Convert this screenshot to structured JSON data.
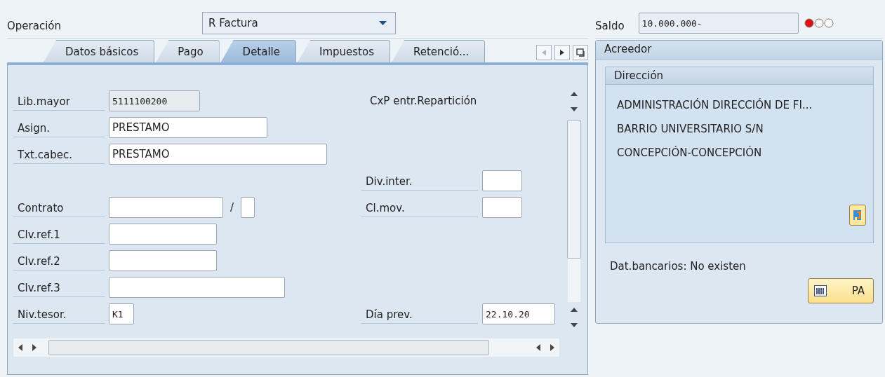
{
  "operation": {
    "label": "Operación",
    "value": "R Factura"
  },
  "tabs": [
    {
      "label": "Datos básicos",
      "selected": false
    },
    {
      "label": "Pago",
      "selected": false
    },
    {
      "label": "Detalle",
      "selected": true
    },
    {
      "label": "Impuestos",
      "selected": false
    },
    {
      "label": "Retenció...",
      "selected": false
    }
  ],
  "form": {
    "rows": [
      {
        "label": "Lib.mayor",
        "fields": [
          {
            "value": "5111100200",
            "kind": "display"
          }
        ],
        "right": {
          "kind": "text",
          "text": "CxP entr.Repartición"
        }
      },
      {
        "label": "Asign.",
        "fields": [
          {
            "value": "PRESTAMO",
            "kind": "input"
          }
        ]
      },
      {
        "label": "Txt.cabec.",
        "fields": [
          {
            "value": "PRESTAMO",
            "kind": "input"
          }
        ]
      },
      {
        "fields": [],
        "right": {
          "kind": "field",
          "label": "Div.inter."
        }
      },
      {
        "label": "Contrato",
        "fields": [
          {
            "kind": "input"
          },
          {
            "kind": "input"
          }
        ],
        "separator": "/",
        "right": {
          "kind": "field",
          "label": "Cl.mov."
        }
      },
      {
        "label": "Clv.ref.1",
        "fields": [
          {
            "kind": "input"
          }
        ]
      },
      {
        "label": "Clv.ref.2",
        "fields": [
          {
            "kind": "input"
          }
        ]
      },
      {
        "label": "Clv.ref.3",
        "fields": [
          {
            "kind": "input"
          }
        ]
      },
      {
        "label": "Niv.tesor.",
        "fields": [
          {
            "value": "K1",
            "kind": "mono"
          }
        ],
        "right": {
          "kind": "field",
          "label": "Día prev.",
          "value": "22.10.20"
        }
      }
    ]
  },
  "balance": {
    "label": "Saldo",
    "value": "10.000.000-",
    "lights": [
      {
        "on": true
      },
      {
        "on": false
      },
      {
        "on": false
      }
    ]
  },
  "creditor": {
    "title": "Acreedor",
    "address": {
      "title": "Dirección",
      "lines": [
        "ADMINISTRACIÓN DIRECCIÓN DE FI...",
        "BARRIO UNIVERSITARIO S/N",
        "CONCEPCIÓN-CONCEPCIÓN"
      ]
    },
    "bank": "Dat.bancarios: No existen",
    "button": "PA"
  }
}
